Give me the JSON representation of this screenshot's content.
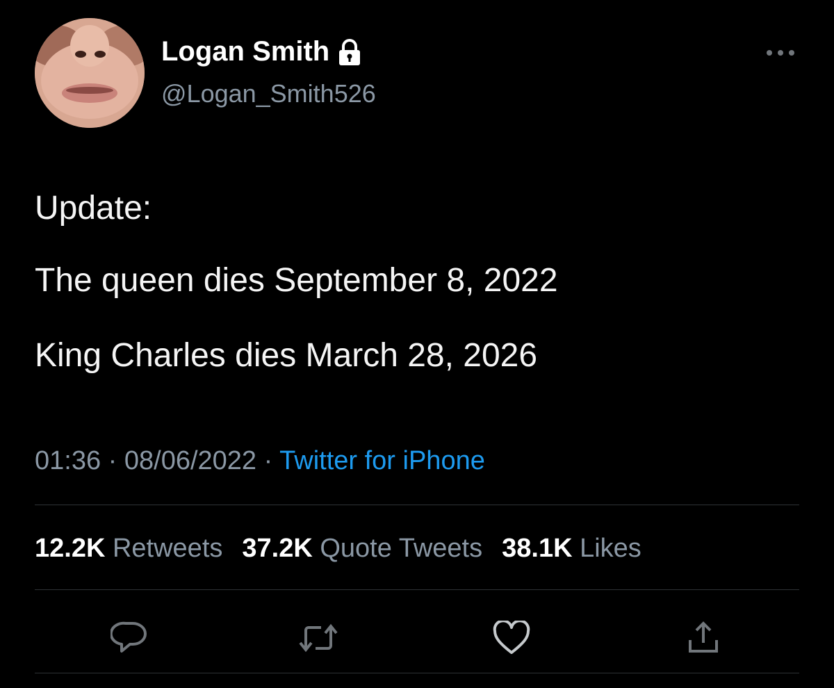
{
  "user": {
    "display_name": "Logan Smith",
    "handle": "@Logan_Smith526",
    "protected_icon": "lock-icon",
    "avatar": "profile-photo"
  },
  "tweet": {
    "lines": [
      "Update:",
      "The queen dies September 8, 2022",
      "King Charles dies March 28, 2026"
    ]
  },
  "meta": {
    "time": "01:36",
    "separator": " · ",
    "date": "08/06/2022",
    "source": "Twitter for iPhone"
  },
  "stats": {
    "retweets": {
      "count": "12.2K",
      "label": "Retweets"
    },
    "quote_tweets": {
      "count": "37.2K",
      "label": "Quote Tweets"
    },
    "likes": {
      "count": "38.1K",
      "label": "Likes"
    }
  },
  "actions": [
    "reply-icon",
    "retweet-icon",
    "like-icon",
    "share-icon"
  ],
  "colors": {
    "background": "#000000",
    "text": "#e7e9ea",
    "secondary": "#8b98a5",
    "link": "#1d9bf0",
    "divider": "#2f3336"
  }
}
